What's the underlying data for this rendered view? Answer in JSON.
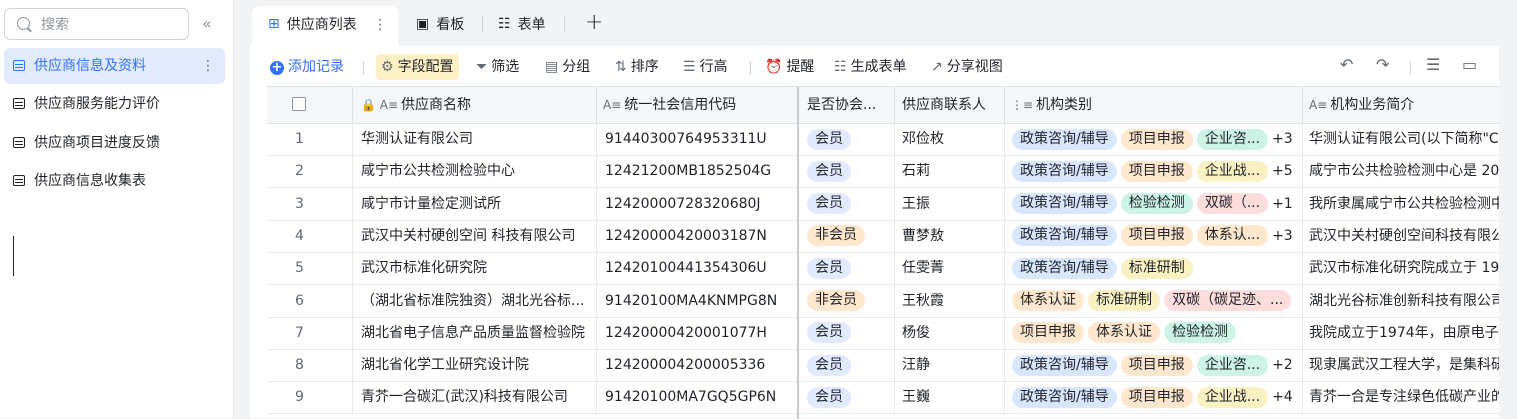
{
  "sidebar": {
    "search_placeholder": "搜索",
    "collapse_glyph": "«",
    "more_glyph": "⋮",
    "items": [
      {
        "label": "供应商信息及资料"
      },
      {
        "label": "供应商服务能力评价"
      },
      {
        "label": "供应商项目进度反馈"
      },
      {
        "label": "供应商信息收集表"
      }
    ]
  },
  "tabs": [
    {
      "label": "供应商列表",
      "icon": "⊞",
      "more": "⋮"
    },
    {
      "label": "看板",
      "icon": "▣"
    },
    {
      "label": "表单",
      "icon": "☷"
    }
  ],
  "add_tab_glyph": "+",
  "toolbar": {
    "add_record": "添加记录",
    "add_glyph": "+",
    "field_config": "字段配置",
    "filter": "筛选",
    "group": "分组",
    "sort": "排序",
    "row_height": "行高",
    "remind": "提醒",
    "gen_form": "生成表单",
    "share_view": "分享视图",
    "icons": {
      "field_config": "⚙",
      "filter": "⏷",
      "group": "▤",
      "sort": "⇅",
      "row_height": "☰",
      "remind": "⏰",
      "gen_form": "☷",
      "share_view": "↗"
    },
    "right_icons": [
      "↶",
      "↷",
      "☰",
      "▭"
    ]
  },
  "columns": [
    {
      "label": "供应商名称",
      "icon": "🔒 A≡"
    },
    {
      "label": "统一社会信用代码",
      "icon": "A≡"
    },
    {
      "label": "是否协会...",
      "icon": ""
    },
    {
      "label": "供应商联系人",
      "icon": ""
    },
    {
      "label": "机构类别",
      "icon": "⋮≡"
    },
    {
      "label": "机构业务简介",
      "icon": "A≡"
    }
  ],
  "rows": [
    {
      "num": "1",
      "name": "华测认证有限公司",
      "code": "91440300764953311U",
      "member": "会员",
      "contact": "邓俭枚",
      "tags": [
        "政策咨询/辅导",
        "项目申报",
        "企业咨..."
      ],
      "more": "+3",
      "intro": "华测认证有限公司(以下简称\"C"
    },
    {
      "num": "2",
      "name": "咸宁市公共检测检验中心",
      "code": "12421200MB1852504G",
      "member": "会员",
      "contact": "石莉",
      "tags": [
        "政策咨询/辅导",
        "项目申报",
        "企业战..."
      ],
      "more": "+5",
      "intro": "咸宁市公共检验检测中心是 20"
    },
    {
      "num": "3",
      "name": "咸宁市计量检定测试所",
      "code": "12420000728320680J",
      "member": "会员",
      "contact": "王振",
      "tags": [
        "政策咨询/辅导",
        "检验检测",
        "双碳（..."
      ],
      "more": "+1",
      "intro": "我所隶属咸宁市公共检验检测中"
    },
    {
      "num": "4",
      "name": "武汉中关村硬创空间 科技有限公司",
      "code": "12420000420003187N",
      "member": "非会员",
      "contact": "曹梦敖",
      "tags": [
        "政策咨询/辅导",
        "项目申报",
        "体系认..."
      ],
      "more": "+3",
      "intro": "武汉中关村硬创空间科技有限公"
    },
    {
      "num": "5",
      "name": "武汉市标准化研究院",
      "code": "12420100441354306U",
      "member": "会员",
      "contact": "任雯菁",
      "tags": [
        "政策咨询/辅导",
        "标准研制"
      ],
      "more": "",
      "intro": "武汉市标准化研究院成立于 19"
    },
    {
      "num": "6",
      "name": "（湖北省标准院独资）湖北光谷标...",
      "code": "91420100MA4KNMPG8N",
      "member": "非会员",
      "contact": "王秋霞",
      "tags": [
        "体系认证",
        "标准研制",
        "双碳（碳足迹、..."
      ],
      "more": "",
      "intro": "湖北光谷标准创新科技有限公司"
    },
    {
      "num": "7",
      "name": "湖北省电子信息产品质量监督检验院",
      "code": "12420000420001077H",
      "member": "会员",
      "contact": "杨俊",
      "tags": [
        "项目申报",
        "体系认证",
        "检验检测"
      ],
      "more": "",
      "intro": "我院成立于1974年，由原电子工"
    },
    {
      "num": "8",
      "name": "湖北省化学工业研究设计院",
      "code": "124200004200005336",
      "member": "会员",
      "contact": "汪静",
      "tags": [
        "政策咨询/辅导",
        "项目申报",
        "企业咨..."
      ],
      "more": "+2",
      "intro": "现隶属武汉工程大学，是集科研"
    },
    {
      "num": "9",
      "name": "青芥一合碳汇(武汉)科技有限公司",
      "code": "91420100MA7GQ5GP6N",
      "member": "会员",
      "contact": "王巍",
      "tags": [
        "政策咨询/辅导",
        "项目申报",
        "企业战..."
      ],
      "more": "+4",
      "intro": "青芥一合是专注绿色低碳产业的"
    }
  ],
  "tag_colors": {
    "政策咨询/辅导": "t-blue",
    "项目申报": "t-orange",
    "企业咨...": "t-green",
    "企业战...": "t-yellow",
    "检验检测": "t-green",
    "双碳（...": "t-pink",
    "体系认...": "t-orange",
    "标准研制": "t-yellow",
    "体系认证": "t-orange",
    "双碳（碳足迹、...": "t-pink"
  },
  "member_colors": {
    "会员": "t-pale",
    "非会员": "t-orange"
  },
  "accent": "#3370ff"
}
